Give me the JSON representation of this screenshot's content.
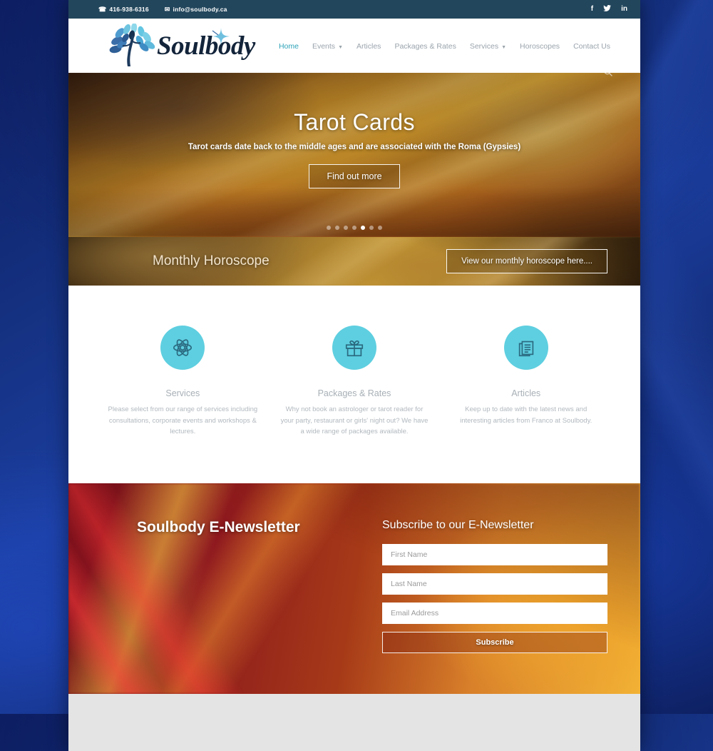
{
  "topbar": {
    "phone": "416-938-6316",
    "email": "info@soulbody.ca",
    "phone_icon": "phone-icon",
    "email_icon": "envelope-icon",
    "social": [
      {
        "name": "facebook-icon",
        "glyph": "f"
      },
      {
        "name": "twitter-icon",
        "glyph": "ᵗ"
      },
      {
        "name": "linkedin-icon",
        "glyph": "in"
      }
    ]
  },
  "header": {
    "logo_text": "Soulbody",
    "nav": [
      {
        "label": "Home",
        "active": true,
        "caret": false
      },
      {
        "label": "Events",
        "active": false,
        "caret": true
      },
      {
        "label": "Articles",
        "active": false,
        "caret": false
      },
      {
        "label": "Packages & Rates",
        "active": false,
        "caret": false
      },
      {
        "label": "Services",
        "active": false,
        "caret": true
      },
      {
        "label": "Horoscopes",
        "active": false,
        "caret": false
      },
      {
        "label": "Contact Us",
        "active": false,
        "caret": false
      }
    ]
  },
  "hero": {
    "title": "Tarot Cards",
    "subtitle": "Tarot cards date back to the middle ages and are associated with the Roma (Gypsies)",
    "button": "Find out more",
    "slide_count": 7,
    "active_slide": 5,
    "search_icon": "search-icon"
  },
  "horoscope": {
    "title": "Monthly Horoscope",
    "button": "View our monthly horoscope here...."
  },
  "features": [
    {
      "icon": "atom-icon",
      "title": "Services",
      "body": "Please select from our range of services including consultations, corporate events and workshops & lectures."
    },
    {
      "icon": "gift-icon",
      "title": "Packages & Rates",
      "body": "Why not book an astrologer or tarot reader for your party, restaurant or girls' night out?  We have a wide range of packages available."
    },
    {
      "icon": "documents-icon",
      "title": "Articles",
      "body": "Keep up to date with the latest news and interesting articles from Franco at Soulbody."
    }
  ],
  "newsletter": {
    "heading": "Soulbody E-Newsletter",
    "subheading": "Subscribe to our E-Newsletter",
    "first_name_placeholder": "First Name",
    "last_name_placeholder": "Last Name",
    "email_placeholder": "Email Address",
    "submit_label": "Subscribe",
    "first_name_value": "",
    "last_name_value": "",
    "email_value": ""
  },
  "colors": {
    "topbar_bg": "#22465c",
    "accent_teal": "#2ea3b8",
    "icon_circle": "#5ecfe0",
    "nav_text": "#9aa4ac",
    "footer_bg": "#e4e4e4"
  }
}
